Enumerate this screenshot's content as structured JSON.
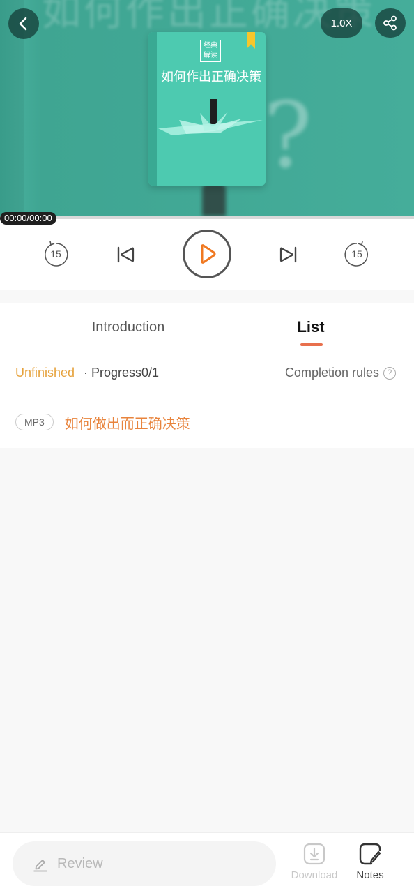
{
  "header": {
    "speed_label": "1.0X",
    "cover_tag_line1": "经典",
    "cover_tag_line2": "解读",
    "cover_title": "如何作出正确决策"
  },
  "player": {
    "time": "00:00/00:00",
    "rewind_seconds": "15",
    "forward_seconds": "15"
  },
  "tabs": [
    {
      "label": "Introduction",
      "active": false
    },
    {
      "label": "List",
      "active": true
    }
  ],
  "status": {
    "state": "Unfinished",
    "progress": "· Progress0/1",
    "rules_label": "Completion rules"
  },
  "items": [
    {
      "type": "MP3",
      "title": "如何做出而正确决策"
    }
  ],
  "bottom": {
    "review_placeholder": "Review",
    "download_label": "Download",
    "notes_label": "Notes"
  },
  "colors": {
    "cover_bg": "#45ad9a",
    "accent": "#e8704d",
    "unfinished": "#e6a23c",
    "item_title": "#e8843d"
  }
}
